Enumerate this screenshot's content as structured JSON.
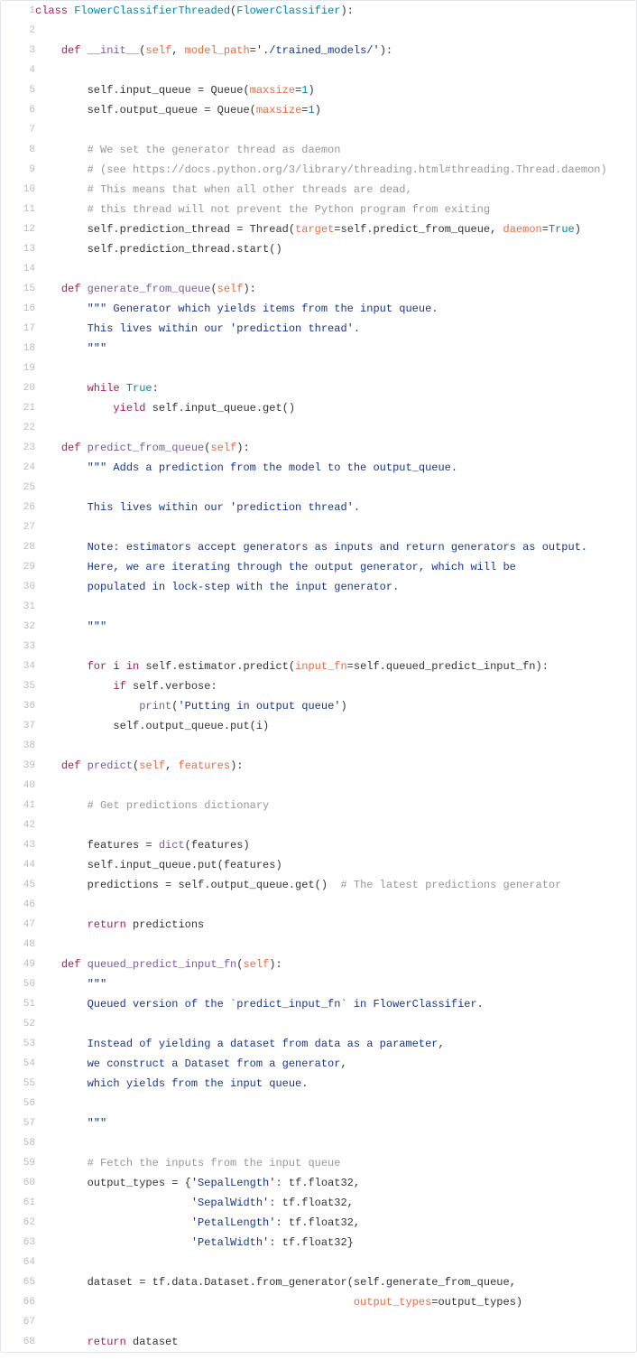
{
  "lines": [
    {
      "n": 1,
      "tokens": [
        {
          "c": "kw",
          "t": "class"
        },
        {
          "c": "",
          "t": " "
        },
        {
          "c": "cls",
          "t": "FlowerClassifierThreaded"
        },
        {
          "c": "",
          "t": "("
        },
        {
          "c": "cls",
          "t": "FlowerClassifier"
        },
        {
          "c": "",
          "t": "):"
        }
      ]
    },
    {
      "n": 2,
      "tokens": []
    },
    {
      "n": 3,
      "tokens": [
        {
          "c": "",
          "t": "    "
        },
        {
          "c": "kw",
          "t": "def"
        },
        {
          "c": "",
          "t": " "
        },
        {
          "c": "fn",
          "t": "__init__"
        },
        {
          "c": "",
          "t": "("
        },
        {
          "c": "param",
          "t": "self"
        },
        {
          "c": "",
          "t": ", "
        },
        {
          "c": "param",
          "t": "model_path"
        },
        {
          "c": "",
          "t": "="
        },
        {
          "c": "str",
          "t": "'./trained_models/'"
        },
        {
          "c": "",
          "t": "):"
        }
      ]
    },
    {
      "n": 4,
      "tokens": []
    },
    {
      "n": 5,
      "tokens": [
        {
          "c": "",
          "t": "        self.input_queue "
        },
        {
          "c": "",
          "t": "= "
        },
        {
          "c": "",
          "t": "Queue("
        },
        {
          "c": "param",
          "t": "maxsize"
        },
        {
          "c": "",
          "t": "="
        },
        {
          "c": "num",
          "t": "1"
        },
        {
          "c": "",
          "t": ")"
        }
      ]
    },
    {
      "n": 6,
      "tokens": [
        {
          "c": "",
          "t": "        self.output_queue "
        },
        {
          "c": "",
          "t": "= "
        },
        {
          "c": "",
          "t": "Queue("
        },
        {
          "c": "param",
          "t": "maxsize"
        },
        {
          "c": "",
          "t": "="
        },
        {
          "c": "num",
          "t": "1"
        },
        {
          "c": "",
          "t": ")"
        }
      ]
    },
    {
      "n": 7,
      "tokens": []
    },
    {
      "n": 8,
      "tokens": [
        {
          "c": "",
          "t": "        "
        },
        {
          "c": "cmt",
          "t": "# We set the generator thread as daemon"
        }
      ]
    },
    {
      "n": 9,
      "tokens": [
        {
          "c": "",
          "t": "        "
        },
        {
          "c": "cmt",
          "t": "# (see https://docs.python.org/3/library/threading.html#threading.Thread.daemon)"
        }
      ]
    },
    {
      "n": 10,
      "tokens": [
        {
          "c": "",
          "t": "        "
        },
        {
          "c": "cmt",
          "t": "# This means that when all other threads are dead,"
        }
      ]
    },
    {
      "n": 11,
      "tokens": [
        {
          "c": "",
          "t": "        "
        },
        {
          "c": "cmt",
          "t": "# this thread will not prevent the Python program from exiting"
        }
      ]
    },
    {
      "n": 12,
      "tokens": [
        {
          "c": "",
          "t": "        self.prediction_thread "
        },
        {
          "c": "",
          "t": "= "
        },
        {
          "c": "",
          "t": "Thread("
        },
        {
          "c": "param",
          "t": "target"
        },
        {
          "c": "",
          "t": "=self.predict_from_queue, "
        },
        {
          "c": "param",
          "t": "daemon"
        },
        {
          "c": "",
          "t": "="
        },
        {
          "c": "bool",
          "t": "True"
        },
        {
          "c": "",
          "t": ")"
        }
      ]
    },
    {
      "n": 13,
      "tokens": [
        {
          "c": "",
          "t": "        self.prediction_thread.start()"
        }
      ]
    },
    {
      "n": 14,
      "tokens": []
    },
    {
      "n": 15,
      "tokens": [
        {
          "c": "",
          "t": "    "
        },
        {
          "c": "kw",
          "t": "def"
        },
        {
          "c": "",
          "t": " "
        },
        {
          "c": "fn",
          "t": "generate_from_queue"
        },
        {
          "c": "",
          "t": "("
        },
        {
          "c": "param",
          "t": "self"
        },
        {
          "c": "",
          "t": "):"
        }
      ]
    },
    {
      "n": 16,
      "tokens": [
        {
          "c": "",
          "t": "        "
        },
        {
          "c": "str",
          "t": "\"\"\" Generator which yields items from the input queue."
        }
      ]
    },
    {
      "n": 17,
      "tokens": [
        {
          "c": "str",
          "t": "        This lives within our 'prediction thread'."
        }
      ]
    },
    {
      "n": 18,
      "tokens": [
        {
          "c": "str",
          "t": "        \"\"\""
        }
      ]
    },
    {
      "n": 19,
      "tokens": []
    },
    {
      "n": 20,
      "tokens": [
        {
          "c": "",
          "t": "        "
        },
        {
          "c": "kw",
          "t": "while"
        },
        {
          "c": "",
          "t": " "
        },
        {
          "c": "bool",
          "t": "True"
        },
        {
          "c": "",
          "t": ":"
        }
      ]
    },
    {
      "n": 21,
      "tokens": [
        {
          "c": "",
          "t": "            "
        },
        {
          "c": "kw",
          "t": "yield"
        },
        {
          "c": "",
          "t": " self.input_queue.get()"
        }
      ]
    },
    {
      "n": 22,
      "tokens": []
    },
    {
      "n": 23,
      "tokens": [
        {
          "c": "",
          "t": "    "
        },
        {
          "c": "kw",
          "t": "def"
        },
        {
          "c": "",
          "t": " "
        },
        {
          "c": "fn",
          "t": "predict_from_queue"
        },
        {
          "c": "",
          "t": "("
        },
        {
          "c": "param",
          "t": "self"
        },
        {
          "c": "",
          "t": "):"
        }
      ]
    },
    {
      "n": 24,
      "tokens": [
        {
          "c": "",
          "t": "        "
        },
        {
          "c": "str",
          "t": "\"\"\" Adds a prediction from the model to the output_queue."
        }
      ]
    },
    {
      "n": 25,
      "tokens": [
        {
          "c": "str",
          "t": ""
        }
      ]
    },
    {
      "n": 26,
      "tokens": [
        {
          "c": "str",
          "t": "        This lives within our 'prediction thread'."
        }
      ]
    },
    {
      "n": 27,
      "tokens": [
        {
          "c": "str",
          "t": ""
        }
      ]
    },
    {
      "n": 28,
      "tokens": [
        {
          "c": "str",
          "t": "        Note: estimators accept generators as inputs and return generators as output."
        }
      ]
    },
    {
      "n": 29,
      "tokens": [
        {
          "c": "str",
          "t": "        Here, we are iterating through the output generator, which will be"
        }
      ]
    },
    {
      "n": 30,
      "tokens": [
        {
          "c": "str",
          "t": "        populated in lock-step with the input generator."
        }
      ]
    },
    {
      "n": 31,
      "tokens": [
        {
          "c": "str",
          "t": ""
        }
      ]
    },
    {
      "n": 32,
      "tokens": [
        {
          "c": "str",
          "t": "        \"\"\""
        }
      ]
    },
    {
      "n": 33,
      "tokens": []
    },
    {
      "n": 34,
      "tokens": [
        {
          "c": "",
          "t": "        "
        },
        {
          "c": "kw",
          "t": "for"
        },
        {
          "c": "",
          "t": " i "
        },
        {
          "c": "kw",
          "t": "in"
        },
        {
          "c": "",
          "t": " self.estimator.predict("
        },
        {
          "c": "param",
          "t": "input_fn"
        },
        {
          "c": "",
          "t": "=self.queued_predict_input_fn):"
        }
      ]
    },
    {
      "n": 35,
      "tokens": [
        {
          "c": "",
          "t": "            "
        },
        {
          "c": "kw",
          "t": "if"
        },
        {
          "c": "",
          "t": " self.verbose:"
        }
      ]
    },
    {
      "n": 36,
      "tokens": [
        {
          "c": "",
          "t": "                "
        },
        {
          "c": "fn",
          "t": "print"
        },
        {
          "c": "",
          "t": "("
        },
        {
          "c": "str",
          "t": "'Putting in output queue'"
        },
        {
          "c": "",
          "t": ")"
        }
      ]
    },
    {
      "n": 37,
      "tokens": [
        {
          "c": "",
          "t": "            self.output_queue.put(i)"
        }
      ]
    },
    {
      "n": 38,
      "tokens": []
    },
    {
      "n": 39,
      "tokens": [
        {
          "c": "",
          "t": "    "
        },
        {
          "c": "kw",
          "t": "def"
        },
        {
          "c": "",
          "t": " "
        },
        {
          "c": "fn",
          "t": "predict"
        },
        {
          "c": "",
          "t": "("
        },
        {
          "c": "param",
          "t": "self"
        },
        {
          "c": "",
          "t": ", "
        },
        {
          "c": "param",
          "t": "features"
        },
        {
          "c": "",
          "t": "):"
        }
      ]
    },
    {
      "n": 40,
      "tokens": []
    },
    {
      "n": 41,
      "tokens": [
        {
          "c": "",
          "t": "        "
        },
        {
          "c": "cmt",
          "t": "# Get predictions dictionary"
        }
      ]
    },
    {
      "n": 42,
      "tokens": []
    },
    {
      "n": 43,
      "tokens": [
        {
          "c": "",
          "t": "        features "
        },
        {
          "c": "",
          "t": "= "
        },
        {
          "c": "fn",
          "t": "dict"
        },
        {
          "c": "",
          "t": "(features)"
        }
      ]
    },
    {
      "n": 44,
      "tokens": [
        {
          "c": "",
          "t": "        self.input_queue.put(features)"
        }
      ]
    },
    {
      "n": 45,
      "tokens": [
        {
          "c": "",
          "t": "        predictions "
        },
        {
          "c": "",
          "t": "= "
        },
        {
          "c": "",
          "t": "self.output_queue.get()  "
        },
        {
          "c": "cmt",
          "t": "# The latest predictions generator"
        }
      ]
    },
    {
      "n": 46,
      "tokens": []
    },
    {
      "n": 47,
      "tokens": [
        {
          "c": "",
          "t": "        "
        },
        {
          "c": "kw",
          "t": "return"
        },
        {
          "c": "",
          "t": " predictions"
        }
      ]
    },
    {
      "n": 48,
      "tokens": []
    },
    {
      "n": 49,
      "tokens": [
        {
          "c": "",
          "t": "    "
        },
        {
          "c": "kw",
          "t": "def"
        },
        {
          "c": "",
          "t": " "
        },
        {
          "c": "fn",
          "t": "queued_predict_input_fn"
        },
        {
          "c": "",
          "t": "("
        },
        {
          "c": "param",
          "t": "self"
        },
        {
          "c": "",
          "t": "):"
        }
      ]
    },
    {
      "n": 50,
      "tokens": [
        {
          "c": "",
          "t": "        "
        },
        {
          "c": "str",
          "t": "\"\"\""
        }
      ]
    },
    {
      "n": 51,
      "tokens": [
        {
          "c": "str",
          "t": "        Queued version of the `predict_input_fn` in FlowerClassifier."
        }
      ]
    },
    {
      "n": 52,
      "tokens": [
        {
          "c": "str",
          "t": ""
        }
      ]
    },
    {
      "n": 53,
      "tokens": [
        {
          "c": "str",
          "t": "        Instead of yielding a dataset from data as a parameter,"
        }
      ]
    },
    {
      "n": 54,
      "tokens": [
        {
          "c": "str",
          "t": "        we construct a Dataset from a generator,"
        }
      ]
    },
    {
      "n": 55,
      "tokens": [
        {
          "c": "str",
          "t": "        which yields from the input queue."
        }
      ]
    },
    {
      "n": 56,
      "tokens": [
        {
          "c": "str",
          "t": ""
        }
      ]
    },
    {
      "n": 57,
      "tokens": [
        {
          "c": "str",
          "t": "        \"\"\""
        }
      ]
    },
    {
      "n": 58,
      "tokens": []
    },
    {
      "n": 59,
      "tokens": [
        {
          "c": "",
          "t": "        "
        },
        {
          "c": "cmt",
          "t": "# Fetch the inputs from the input queue"
        }
      ]
    },
    {
      "n": 60,
      "tokens": [
        {
          "c": "",
          "t": "        output_types "
        },
        {
          "c": "",
          "t": "= "
        },
        {
          "c": "",
          "t": "{"
        },
        {
          "c": "str",
          "t": "'SepalLength'"
        },
        {
          "c": "",
          "t": ": tf.float32,"
        }
      ]
    },
    {
      "n": 61,
      "tokens": [
        {
          "c": "",
          "t": "                        "
        },
        {
          "c": "str",
          "t": "'SepalWidth'"
        },
        {
          "c": "",
          "t": ": tf.float32,"
        }
      ]
    },
    {
      "n": 62,
      "tokens": [
        {
          "c": "",
          "t": "                        "
        },
        {
          "c": "str",
          "t": "'PetalLength'"
        },
        {
          "c": "",
          "t": ": tf.float32,"
        }
      ]
    },
    {
      "n": 63,
      "tokens": [
        {
          "c": "",
          "t": "                        "
        },
        {
          "c": "str",
          "t": "'PetalWidth'"
        },
        {
          "c": "",
          "t": ": tf.float32}"
        }
      ]
    },
    {
      "n": 64,
      "tokens": []
    },
    {
      "n": 65,
      "tokens": [
        {
          "c": "",
          "t": "        dataset "
        },
        {
          "c": "",
          "t": "= "
        },
        {
          "c": "",
          "t": "tf.data.Dataset.from_generator(self.generate_from_queue,"
        }
      ]
    },
    {
      "n": 66,
      "tokens": [
        {
          "c": "",
          "t": "                                                 "
        },
        {
          "c": "param",
          "t": "output_types"
        },
        {
          "c": "",
          "t": "=output_types)"
        }
      ]
    },
    {
      "n": 67,
      "tokens": []
    },
    {
      "n": 68,
      "tokens": [
        {
          "c": "",
          "t": "        "
        },
        {
          "c": "kw",
          "t": "return"
        },
        {
          "c": "",
          "t": " dataset"
        }
      ]
    }
  ]
}
